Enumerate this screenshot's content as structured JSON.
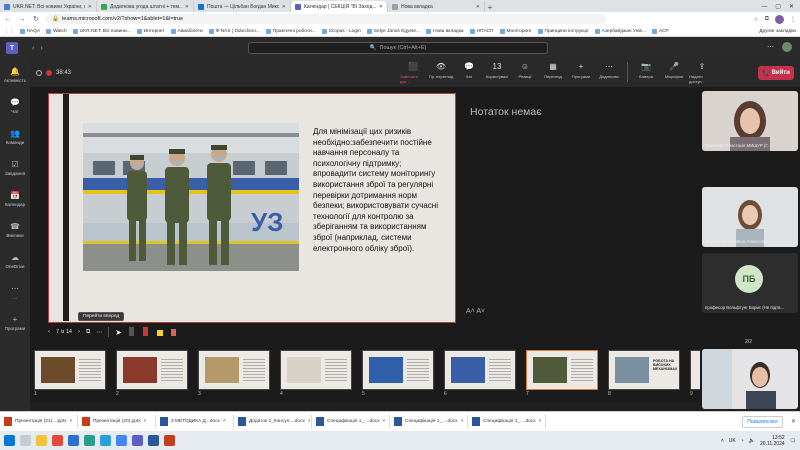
{
  "browser": {
    "tabs": [
      {
        "title": "UKR.NET: Всі новини України, о...",
        "color": "#4a7bd4",
        "active": false
      },
      {
        "title": "Додаткова угода штатні + тем...",
        "color": "#34a853",
        "active": false
      },
      {
        "title": "Пошта — Цільбан Богдан Мико...",
        "color": "#0078d4",
        "active": false
      },
      {
        "title": "Календар | СЕКЦІЯ \"ВІ Заход...",
        "color": "#5b5fc7",
        "active": true
      },
      {
        "title": "Нова вкладка",
        "color": "#9aa0a6",
        "active": false
      }
    ],
    "new_tab": "+",
    "url": "teams.microsoft.com/v2/?show=1&ablet=1&l=true",
    "bookmarks": [
      "HAQA",
      "Watch",
      "UKR.NET: Всі новини...",
      "Интернет",
      "Авиабілети",
      "Ф NÁS | Diánchino...",
      "Практичні роботи...",
      "Scopus - Login",
      "Selye János Egyete...",
      "Нова вкладка",
      "НПАСП",
      "Моніторинг",
      "Принципи інструкції",
      "Азербайджан Унів...",
      "АСР"
    ],
    "other_bookmarks": "Другие закладки"
  },
  "teams": {
    "search_placeholder": "Пошук (Ctrl+Alt+E)",
    "rail": [
      {
        "label": "Активність",
        "icon": "bell-icon",
        "glyph": "🔔"
      },
      {
        "label": "Чат",
        "icon": "chat-icon",
        "glyph": "💬"
      },
      {
        "label": "Команди",
        "icon": "teams-icon",
        "glyph": "👥"
      },
      {
        "label": "Завдання",
        "icon": "tasks-icon",
        "glyph": "☑"
      },
      {
        "label": "Календар",
        "icon": "calendar-icon",
        "glyph": "📅"
      },
      {
        "label": "Виклики",
        "icon": "phone-icon",
        "glyph": "☎"
      },
      {
        "label": "OneDrive",
        "icon": "cloud-icon",
        "glyph": "☁"
      },
      {
        "label": "...",
        "icon": "more-icon",
        "glyph": "⋯"
      },
      {
        "label": "Програми",
        "icon": "apps-icon",
        "glyph": "+"
      }
    ],
    "meeting": {
      "timer": "38:43",
      "controls": [
        {
          "label": "Закінчити дос...",
          "icon": "share-stop-icon",
          "glyph": "⬛",
          "red": true
        },
        {
          "label": "Пр. перегляд",
          "icon": "eye-icon",
          "glyph": "👁",
          "red": false
        },
        {
          "label": "Чат",
          "icon": "chat-icon",
          "glyph": "💬",
          "red": false
        },
        {
          "label": "Користувачі",
          "icon": "people-icon",
          "glyph": "13",
          "red": false
        },
        {
          "label": "Реакції",
          "icon": "emoji-icon",
          "glyph": "☺",
          "red": false
        },
        {
          "label": "Перегляд",
          "icon": "grid-icon",
          "glyph": "▦",
          "red": false
        },
        {
          "label": "Програми",
          "icon": "apps-icon",
          "glyph": "+",
          "red": false
        },
        {
          "label": "Додатково",
          "icon": "more-icon",
          "glyph": "⋯",
          "red": false
        },
        {
          "label": "Камера",
          "icon": "camera-icon",
          "glyph": "📷",
          "red": false
        },
        {
          "label": "Мікрофон",
          "icon": "mic-icon",
          "glyph": "🎤",
          "red": false
        },
        {
          "label": "Надати доступ",
          "icon": "share-icon",
          "glyph": "⇪",
          "red": false
        }
      ],
      "leave_label": "Вийти"
    }
  },
  "presentation": {
    "slide_text": "Для мінімізації цих ризиків необхідно:забезпечити постійне навчання персоналу та психологічну підтримку; впровадити систему моніторингу використання зброї та регулярні перевірки дотримання норм безпеки; використовувати сучасні технології для контролю за зберіганням та використанням зброї (наприклад, системи електронного обліку зброї).",
    "notes": "Нотаток немає",
    "font_controls": "A˄  A˅",
    "page_indicator": "7 із 14",
    "tooltip": "Перейти вперед",
    "thumbnails": [
      {
        "num": "1",
        "active": false
      },
      {
        "num": "2",
        "active": false
      },
      {
        "num": "3",
        "active": false
      },
      {
        "num": "4",
        "active": false
      },
      {
        "num": "5",
        "active": false
      },
      {
        "num": "6",
        "active": false
      },
      {
        "num": "7",
        "active": true
      },
      {
        "num": "8",
        "active": false
      },
      {
        "num": "9",
        "active": false
      }
    ],
    "thumb8_text": "РОБОТА НА ВИСОКИХ МЕХАНІЗМАХ"
  },
  "participants": [
    {
      "name": "Марченко Анастасія МИШУР (Г...",
      "type": "video"
    },
    {
      "name": "Марина Миколаївна Алексєєва",
      "type": "video"
    },
    {
      "name": "професор Вольфтунг Борис (Не підтв...",
      "type": "avatar",
      "initials": "ПБ"
    },
    {
      "name": "",
      "type": "video"
    }
  ],
  "pager": "2/2",
  "downloads": {
    "items": [
      {
        "name": "Презентація (21)....pptx",
        "kind": "ppt"
      },
      {
        "name": "Презентація (20).pptx",
        "kind": "ppt"
      },
      {
        "name": "3 МЕТОДИКА Д...docx",
        "kind": "doc"
      },
      {
        "name": "Додаток 2_Консул....docx",
        "kind": "doc"
      },
      {
        "name": "Специфікація 1_....docx",
        "kind": "doc"
      },
      {
        "name": "Специфікація 1_....docx",
        "kind": "doc"
      },
      {
        "name": "Специфікація 1_....docx",
        "kind": "doc"
      }
    ],
    "show_all": "Показати все"
  },
  "taskbar": {
    "lang": "UK",
    "time": "13:52",
    "date": "20.11.2024"
  }
}
